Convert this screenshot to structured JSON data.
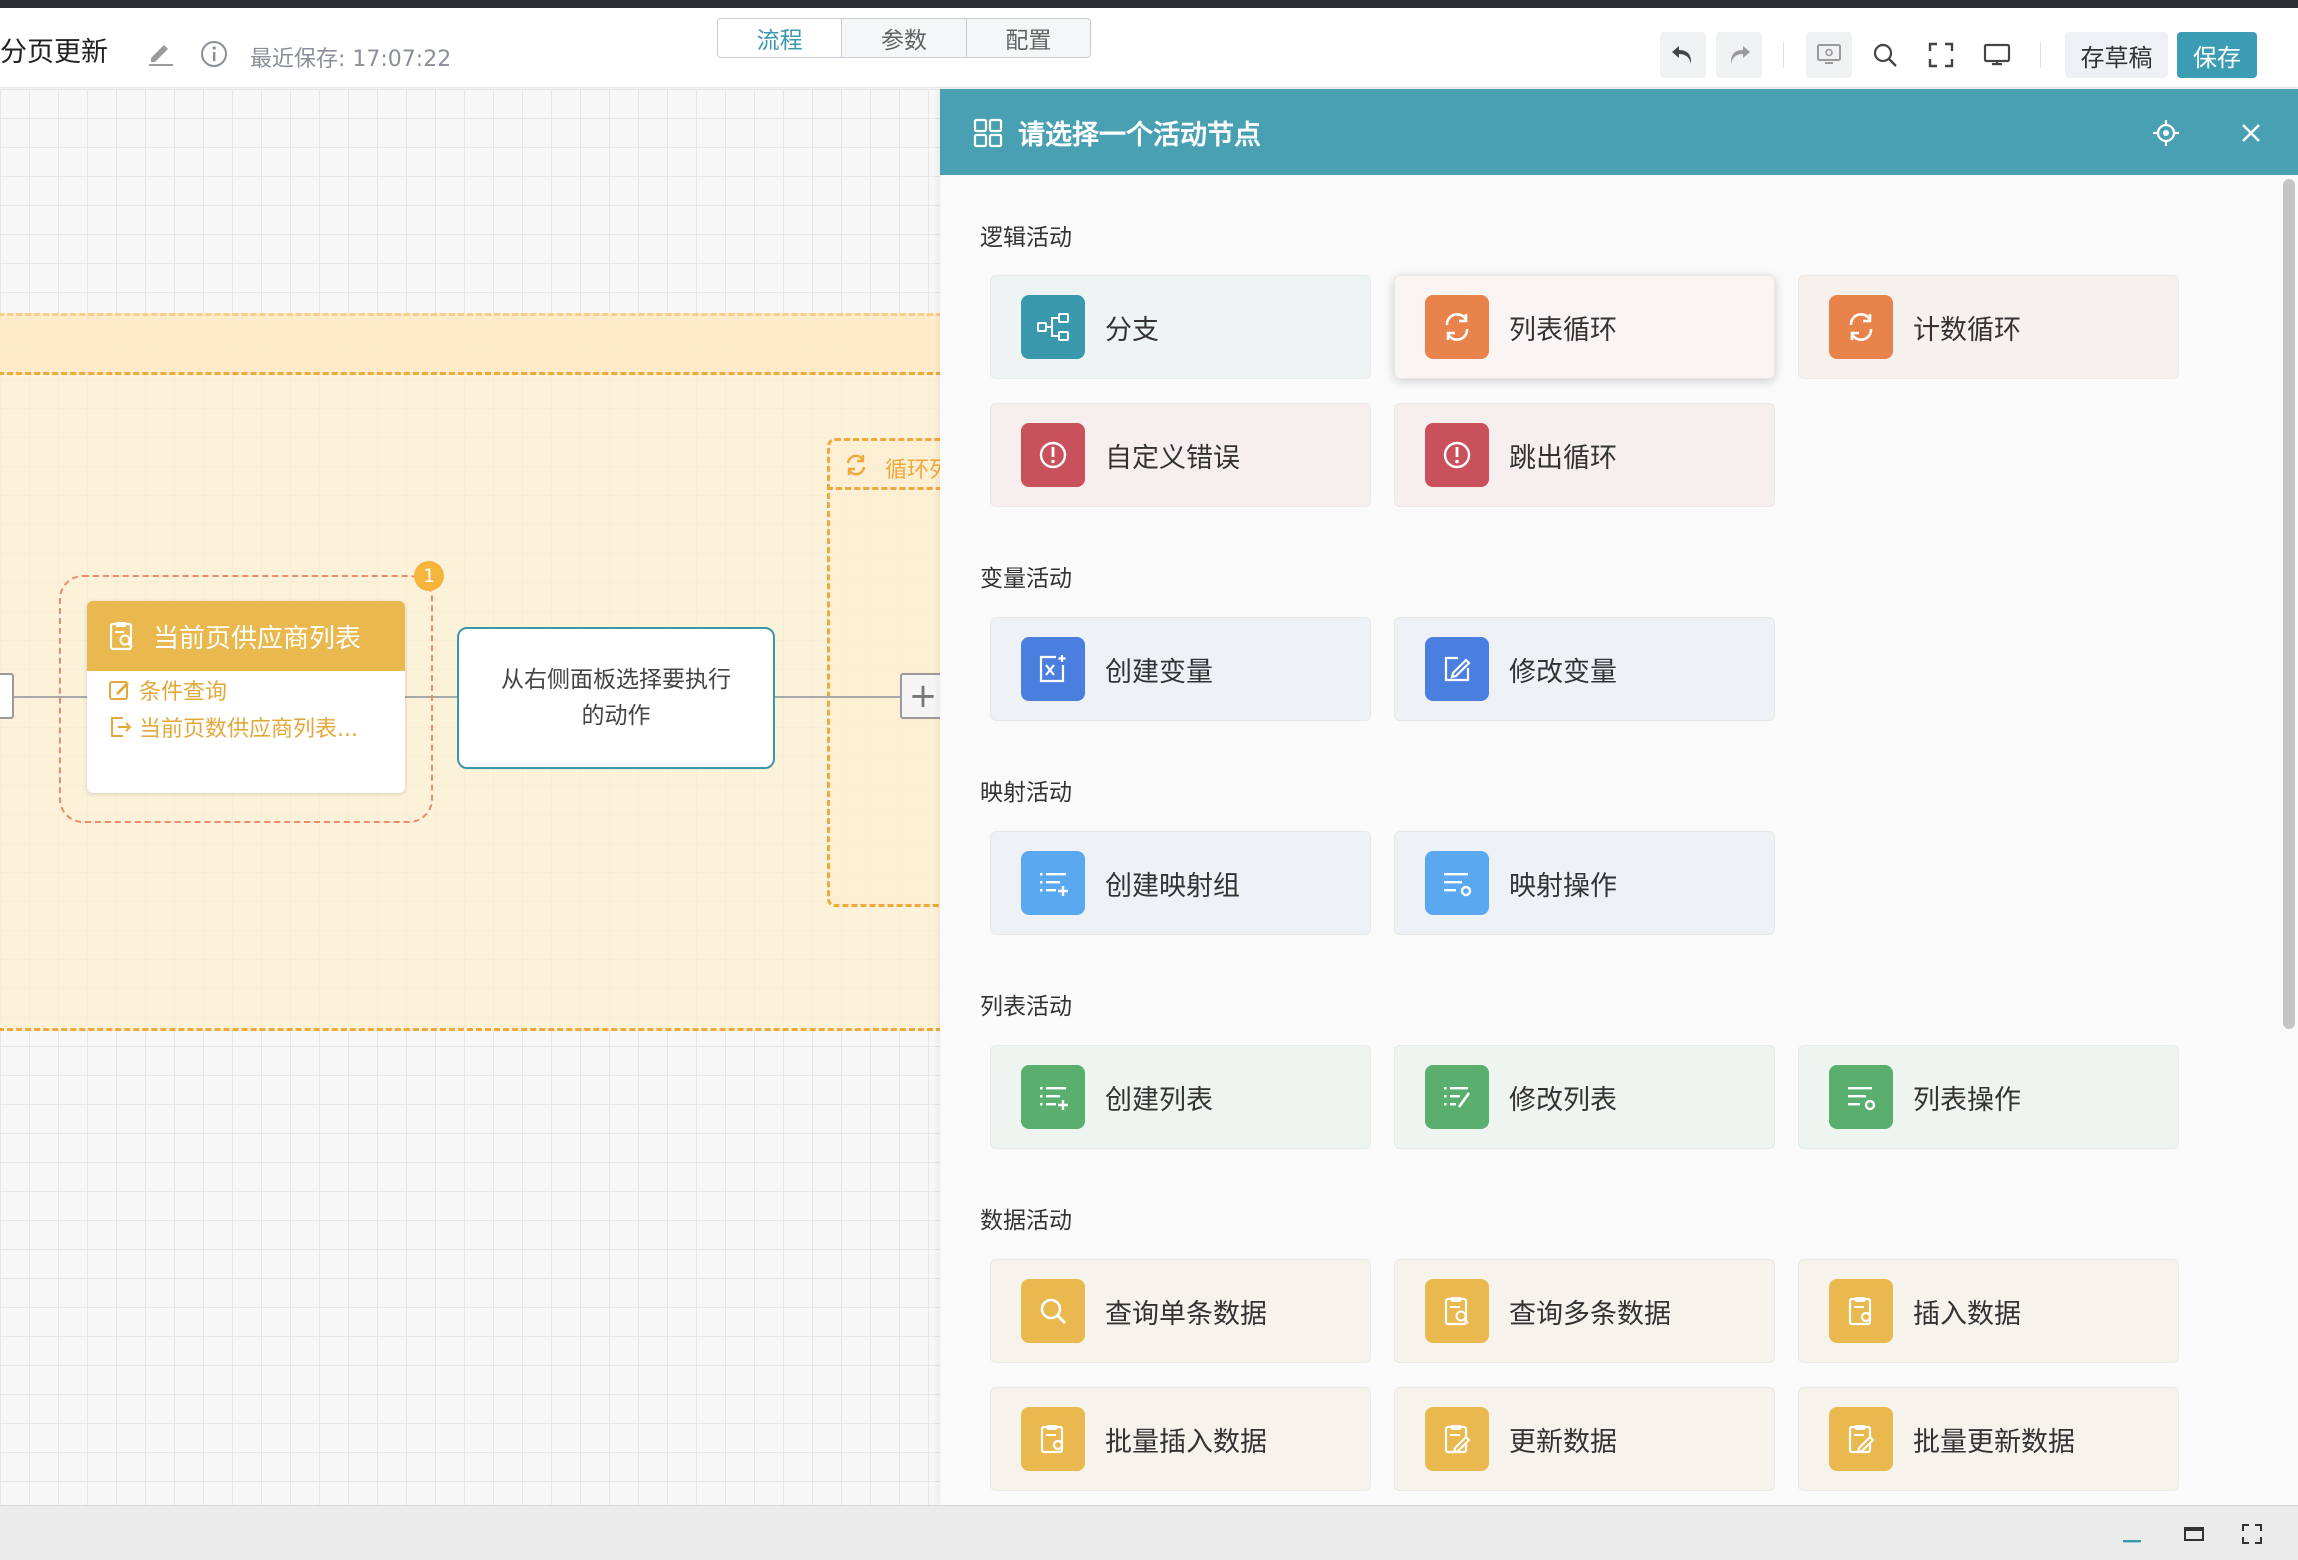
{
  "header": {
    "title": "分页更新",
    "last_saved": "最近保存: 17:07:22",
    "tabs": [
      {
        "label": "流程",
        "active": true
      },
      {
        "label": "参数",
        "active": false
      },
      {
        "label": "配置",
        "active": false
      }
    ],
    "draft_label": "存草稿",
    "save_label": "保存",
    "accent_color": "#3c9cb3"
  },
  "canvas": {
    "inner_loop_label": "循环列",
    "query_node": {
      "title": "当前页供应商列表",
      "badge": "1",
      "rows": [
        "条件查询",
        "当前页数供应商列表..."
      ]
    },
    "action_node": {
      "text": "从右侧面板选择要执行的动作"
    },
    "add_symbol": "+"
  },
  "panel": {
    "title": "请选择一个活动节点",
    "sections": [
      {
        "title": "逻辑活动",
        "items": [
          {
            "label": "分支",
            "icon": "branch-icon",
            "color": "#3a98ad"
          },
          {
            "label": "列表循环",
            "icon": "loop-icon",
            "color": "#e8834c"
          },
          {
            "label": "计数循环",
            "icon": "loop-icon",
            "color": "#e8834c"
          },
          {
            "label": "自定义错误",
            "icon": "error-icon",
            "color": "#c9515c"
          },
          {
            "label": "跳出循环",
            "icon": "error-icon",
            "color": "#c9515c"
          }
        ]
      },
      {
        "title": "变量活动",
        "items": [
          {
            "label": "创建变量",
            "icon": "variable-icon",
            "color": "#4a7fe0"
          },
          {
            "label": "修改变量",
            "icon": "edit-icon",
            "color": "#4a7fe0"
          }
        ]
      },
      {
        "title": "映射活动",
        "items": [
          {
            "label": "创建映射组",
            "icon": "list-add-icon",
            "color": "#5aa8f0"
          },
          {
            "label": "映射操作",
            "icon": "list-gear-icon",
            "color": "#5aa8f0"
          }
        ]
      },
      {
        "title": "列表活动",
        "items": [
          {
            "label": "创建列表",
            "icon": "list-add-icon",
            "color": "#5aaf6e"
          },
          {
            "label": "修改列表",
            "icon": "list-edit-icon",
            "color": "#5aaf6e"
          },
          {
            "label": "列表操作",
            "icon": "list-gear-icon",
            "color": "#5aaf6e"
          }
        ]
      },
      {
        "title": "数据活动",
        "items": [
          {
            "label": "查询单条数据",
            "icon": "search-icon",
            "color": "#e9b94f"
          },
          {
            "label": "查询多条数据",
            "icon": "clipboard-search-icon",
            "color": "#e9b94f"
          },
          {
            "label": "插入数据",
            "icon": "clipboard-gear-icon",
            "color": "#e9b94f"
          },
          {
            "label": "批量插入数据",
            "icon": "clipboard-gear-icon",
            "color": "#e9b94f"
          },
          {
            "label": "更新数据",
            "icon": "clipboard-edit-icon",
            "color": "#e9b94f"
          },
          {
            "label": "批量更新数据",
            "icon": "clipboard-edit-icon",
            "color": "#e9b94f"
          }
        ]
      }
    ]
  }
}
